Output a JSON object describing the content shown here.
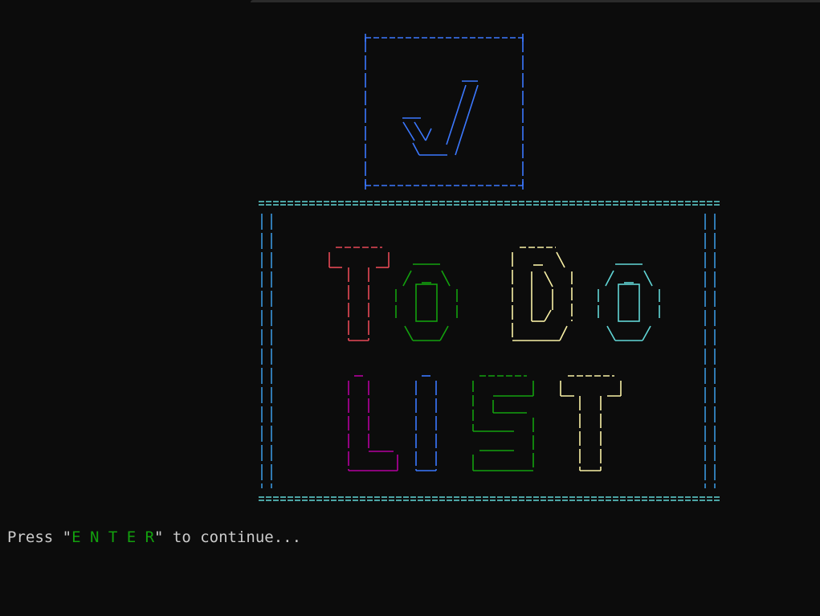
{
  "colors": {
    "background": "#0c0c0c",
    "checkbox": "#3b78ff",
    "frame": "#3a96dd",
    "frame_rule": "#61d6d6",
    "letter_T": "#e74856",
    "letter_o1": "#13a10e",
    "letter_D": "#f9f1a5",
    "letter_o2": "#61d6d6",
    "letter_L": "#b4009e",
    "letter_I": "#3b78ff",
    "letter_S": "#13a10e",
    "letter_T2": "#f9f1a5",
    "text": "#cccccc",
    "key": "#13a10e"
  },
  "logo": {
    "checkbox_icon": "checkmark-icon",
    "words": [
      "To",
      "Do",
      "LIST"
    ]
  },
  "prompt": {
    "before": "Press \"",
    "key": "E N T E R",
    "after": "\" to continue..."
  }
}
